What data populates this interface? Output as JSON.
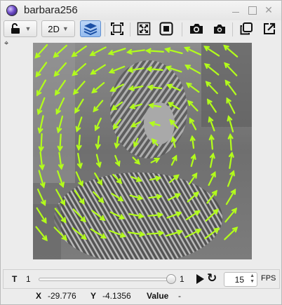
{
  "window": {
    "title": "barbara256",
    "controls": [
      "minimize",
      "maximize",
      "close"
    ]
  },
  "toolbar": {
    "lock_icon": "unlocked-padlock-icon",
    "mode_value": "2D",
    "layers_icon": "layers-icon",
    "icons": [
      "fit-frame-icon",
      "expand-icon",
      "record-stop-icon",
      "camera-large-icon",
      "camera-small-icon",
      "duplicate-icon",
      "open-external-icon"
    ]
  },
  "viewer": {
    "image": "barbara256",
    "overlay": "vector-field arrows",
    "arrow_color": "#b3ff1a",
    "accent_arrow_color": "#6cff2a"
  },
  "playback": {
    "t_label": "T",
    "t_min": "1",
    "t_max": "1",
    "t_value": 1,
    "fps_value": "15",
    "fps_label": "FPS"
  },
  "status": {
    "x_label": "X",
    "x_value": "-29.776",
    "y_label": "Y",
    "y_value": "-4.1356",
    "value_label": "Value",
    "value_value": "-"
  }
}
